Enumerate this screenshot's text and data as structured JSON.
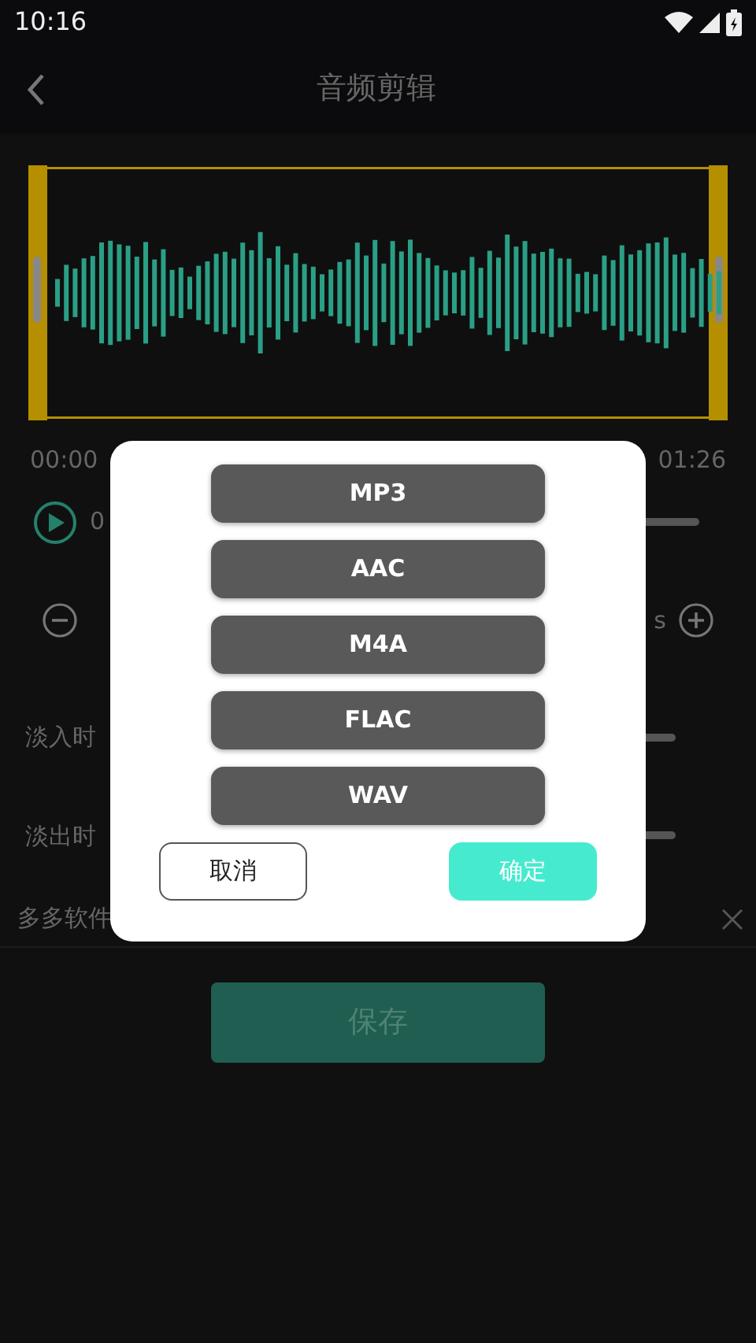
{
  "status_bar": {
    "time": "10:16"
  },
  "header": {
    "title": "音频剪辑"
  },
  "editor": {
    "start_time": "00:00",
    "end_time": "01:26"
  },
  "play_row": {
    "elapsed": "0"
  },
  "duration_row": {
    "unit": "s"
  },
  "fade_in": {
    "label": "淡入时"
  },
  "fade_out": {
    "label": "淡出时"
  },
  "ad_bar": {
    "text": "多多软件"
  },
  "save_button": {
    "label": "保存"
  },
  "dialog": {
    "formats": [
      "MP3",
      "AAC",
      "M4A",
      "FLAC",
      "WAV"
    ],
    "cancel": "取消",
    "confirm": "确定"
  }
}
